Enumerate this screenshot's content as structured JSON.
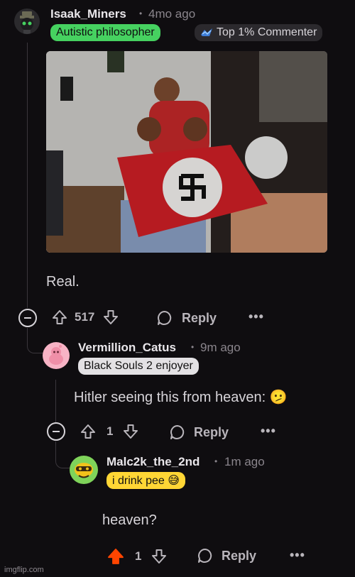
{
  "comments": [
    {
      "username": "Isaak_Miners",
      "separator": "•",
      "time": "4mo ago",
      "flair_primary": "Autistic philosopher",
      "flair_secondary": "Top 1% Commenter",
      "body": "Real.",
      "votes": "517",
      "reply_label": "Reply",
      "more_label": "•••",
      "flair_color": "#46d160"
    },
    {
      "username": "Vermillion_Catus",
      "separator": "•",
      "time": "9m ago",
      "flair": "Black Souls 2 enjoyer",
      "body": "Hitler seeing this from heaven: 🫤",
      "votes": "1",
      "reply_label": "Reply",
      "more_label": "•••"
    },
    {
      "username": "Malc2k_the_2nd",
      "separator": "•",
      "time": "1m ago",
      "flair": "i drink pee 😅",
      "body": "heaven?",
      "votes": "1",
      "reply_label": "Reply",
      "more_label": "•••",
      "upvoted": true,
      "upvote_color": "#ff4500"
    }
  ],
  "watermark": "imgflip.com",
  "icons": [
    "collapse-icon",
    "upvote-icon",
    "downvote-icon",
    "comment-bubble-icon",
    "more-options-icon",
    "top-commenter-icon"
  ]
}
